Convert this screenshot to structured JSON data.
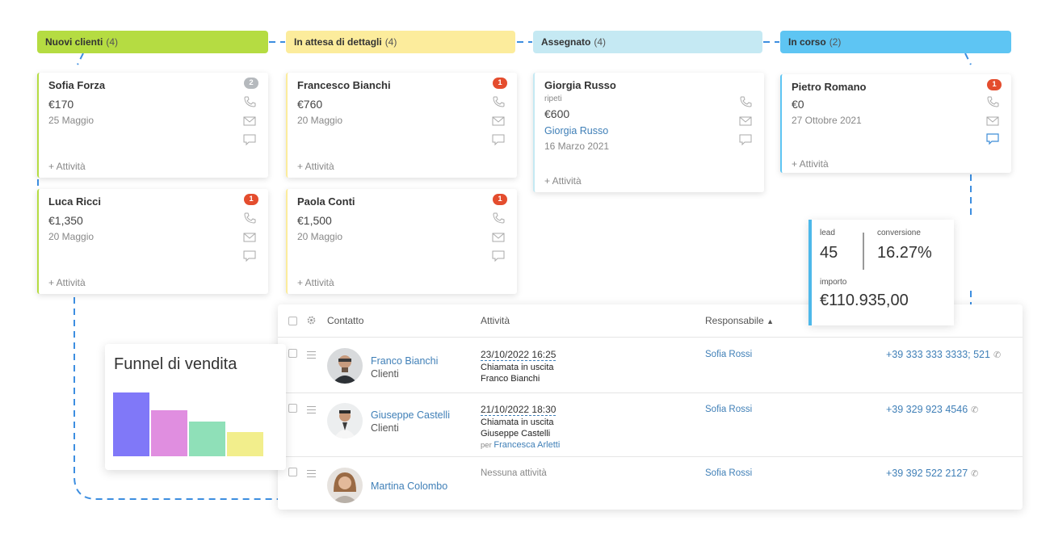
{
  "columns": [
    {
      "title": "Nuovi clienti",
      "count": "(4)",
      "color": "#b5dc42"
    },
    {
      "title": "In attesa di dettagli",
      "count": "(4)",
      "color": "#fcec9c"
    },
    {
      "title": "Assegnato",
      "count": "(4)",
      "color": "#c5e9f3"
    },
    {
      "title": "In corso",
      "count": "(2)",
      "color": "#5ec5f3"
    }
  ],
  "cards": {
    "sofia": {
      "name": "Sofia Forza",
      "amount": "€170",
      "date": "25 Maggio",
      "badge": "2",
      "activity": "+ Attività"
    },
    "luca": {
      "name": "Luca Ricci",
      "amount": "€1,350",
      "date": "20 Maggio",
      "badge": "1",
      "activity": "+ Attività"
    },
    "francesco": {
      "name": "Francesco Bianchi",
      "amount": "€760",
      "date": "20 Maggio",
      "badge": "1",
      "activity": "+ Attività"
    },
    "paola": {
      "name": "Paola Conti",
      "amount": "€1,500",
      "date": "20 Maggio",
      "badge": "1",
      "activity": "+ Attività"
    },
    "giorgia": {
      "name": "Giorgia Russo",
      "sub": "ripeti",
      "amount": "€600",
      "link": "Giorgia Russo",
      "date": "16 Marzo 2021",
      "activity": "+ Attività"
    },
    "pietro": {
      "name": "Pietro Romano",
      "amount": "€0",
      "date": "27 Ottobre 2021",
      "badge": "1",
      "activity": "+ Attività"
    }
  },
  "stats": {
    "lead_label": "lead",
    "lead_value": "45",
    "conv_label": "conversione",
    "conv_value": "16.27%",
    "amount_label": "importo",
    "amount_value": "€110.935,00"
  },
  "funnel": {
    "title": "Funnel di vendita",
    "bars": [
      {
        "value": 1.0,
        "color": "#8078f8"
      },
      {
        "value": 0.72,
        "color": "#e08ee0"
      },
      {
        "value": 0.54,
        "color": "#8fe0b8"
      },
      {
        "value": 0.38,
        "color": "#f2ee8c"
      }
    ]
  },
  "table": {
    "headers": {
      "contact": "Contatto",
      "activity": "Attività",
      "responsible": "Responsabile",
      "sort_icon": "chevron-up-icon"
    },
    "rows": [
      {
        "name": "Franco Bianchi",
        "category": "Clienti",
        "act_date": "23/10/2022 16:25",
        "act_line1": "Chiamata in uscita",
        "act_line2": "Franco Bianchi",
        "responsible": "Sofia Rossi",
        "phone": "+39 333 333 3333; 521"
      },
      {
        "name": "Giuseppe Castelli",
        "category": "Clienti",
        "act_date": "21/10/2022 18:30",
        "act_line1": "Chiamata in uscita",
        "act_line2": "Giuseppe Castelli",
        "act_by": "per",
        "act_by_name": "Francesca Arletti",
        "responsible": "Sofia Rossi",
        "phone": "+39 329 923 4546"
      },
      {
        "name": "Martina Colombo",
        "act_none": "Nessuna attività",
        "responsible": "Sofia Rossi",
        "phone": "+39 392 522 2127"
      }
    ]
  }
}
